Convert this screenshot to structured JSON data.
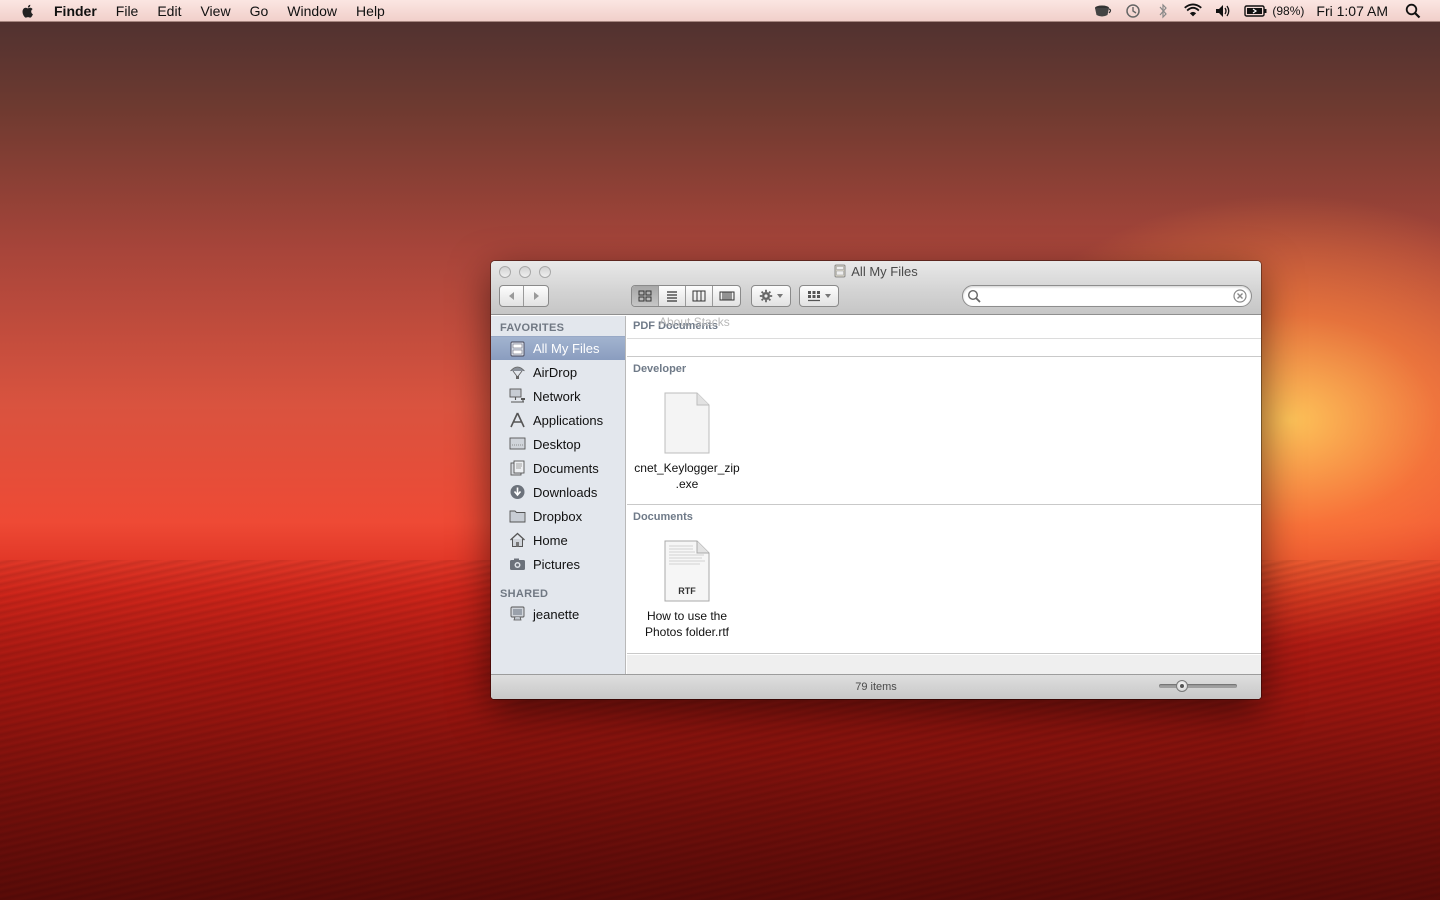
{
  "menubar": {
    "app_name": "Finder",
    "menus": [
      "File",
      "Edit",
      "View",
      "Go",
      "Window",
      "Help"
    ],
    "battery_percent": "(98%)",
    "clock": "Fri 1:07 AM"
  },
  "window": {
    "title": "All My Files",
    "search": {
      "value": "",
      "placeholder": ""
    },
    "sidebar": {
      "favorites_header": "FAVORITES",
      "favorites": [
        {
          "label": "All My Files",
          "icon": "all-my-files-icon",
          "selected": true
        },
        {
          "label": "AirDrop",
          "icon": "airdrop-icon"
        },
        {
          "label": "Network",
          "icon": "network-icon"
        },
        {
          "label": "Applications",
          "icon": "applications-icon"
        },
        {
          "label": "Desktop",
          "icon": "desktop-icon"
        },
        {
          "label": "Documents",
          "icon": "documents-icon"
        },
        {
          "label": "Downloads",
          "icon": "downloads-icon"
        },
        {
          "label": "Dropbox",
          "icon": "folder-icon"
        },
        {
          "label": "Home",
          "icon": "home-icon"
        },
        {
          "label": "Pictures",
          "icon": "camera-icon"
        }
      ],
      "shared_header": "SHARED",
      "shared": [
        {
          "label": "jeanette",
          "icon": "computer-icon"
        }
      ]
    },
    "groups": [
      {
        "label": "PDF Documents",
        "overlay_text": "About Stacks"
      },
      {
        "label": "Developer",
        "files": [
          {
            "name_line1": "cnet_Keylogger_zip",
            "name_line2": ".exe",
            "icon": "generic-document-icon"
          }
        ]
      },
      {
        "label": "Documents",
        "files": [
          {
            "name_line1": "How to use the",
            "name_line2": "Photos folder.rtf",
            "icon": "rtf-document-icon",
            "badge": "RTF"
          }
        ]
      }
    ],
    "status": {
      "item_count": "79 items",
      "icon_size_level": 0.25
    }
  }
}
